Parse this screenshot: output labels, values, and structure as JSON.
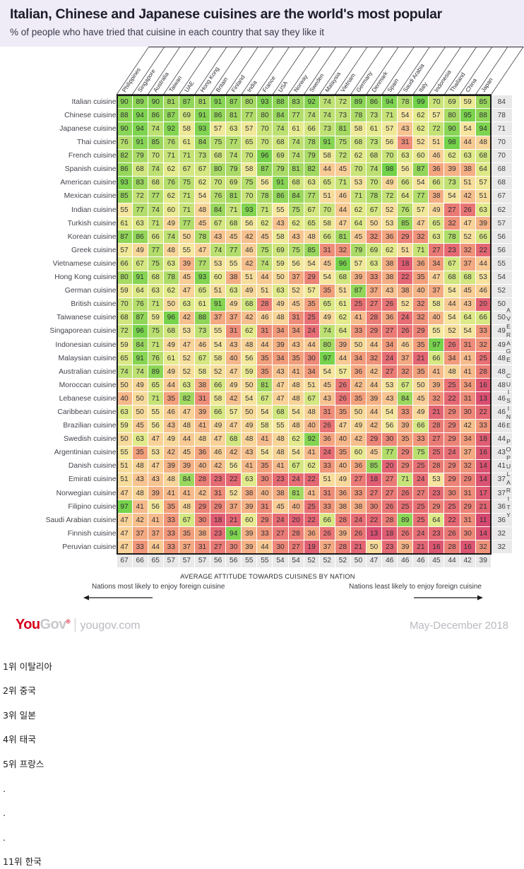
{
  "header": {
    "title": "Italian, Chinese and Japanese cuisines are the world's most popular",
    "subtitle": "% of people who have tried that cuisine in each country that say they like it"
  },
  "footer": {
    "logo_you": "You",
    "logo_gov": "Gov",
    "logo_tm": "®",
    "logo_domain": "yougov.com",
    "date": "May-December 2018"
  },
  "axis": {
    "bottom_caption": "AVERAGE ATTITUDE TOWARDS CUISINES BY NATION",
    "left_note": "Nations most likely to enjoy foreign cuisine",
    "right_note": "Nations least likely to enjoy foreign cuisine",
    "right_vertical_label": "AVERAGE CUISINE POPULARITY"
  },
  "korean_notes": [
    "1위 이탈리아",
    "2위 중국",
    "3위 일본",
    "4위 태국",
    "5위 프랑스",
    ".",
    ".",
    ".",
    "11위 한국"
  ],
  "palette": {
    "high": "#7ed957",
    "mid": "#f2e98a",
    "low": "#e8607a",
    "avg_bg": "#e9e9e9",
    "header_bg": "#efecf7",
    "brand_red": "#d6001c"
  },
  "chart_data": {
    "type": "heatmap",
    "title": "Italian, Chinese and Japanese cuisines are the world's most popular",
    "subtitle": "% of people who have tried that cuisine in each country that say they like it",
    "xlabel": "AVERAGE ATTITUDE TOWARDS CUISINES BY NATION",
    "ylabel": "AVERAGE CUISINE POPULARITY",
    "value_range": [
      11,
      99
    ],
    "columns": [
      "Philippines",
      "Singapore",
      "Australia",
      "Taiwan",
      "UAE",
      "Hong Kong",
      "Britain",
      "Finland",
      "India",
      "France",
      "USA",
      "Norway",
      "Sweden",
      "Malaysia",
      "Vietnam",
      "Germany",
      "Denmark",
      "Spain",
      "Saudi Arabia",
      "Italy",
      "Indonesia",
      "Thailand",
      "China",
      "Japan"
    ],
    "rows": [
      {
        "label": "Italian cuisine",
        "values": [
          90,
          89,
          90,
          81,
          87,
          81,
          91,
          87,
          80,
          93,
          88,
          83,
          92,
          74,
          72,
          89,
          86,
          94,
          78,
          99,
          70,
          69,
          59,
          85
        ],
        "avg": 84
      },
      {
        "label": "Chinese cuisine",
        "values": [
          88,
          94,
          86,
          87,
          69,
          91,
          86,
          81,
          77,
          80,
          84,
          77,
          74,
          74,
          73,
          78,
          73,
          71,
          54,
          62,
          57,
          80,
          95,
          88
        ],
        "avg": 78
      },
      {
        "label": "Japanese cuisine",
        "values": [
          90,
          94,
          74,
          92,
          58,
          93,
          57,
          63,
          57,
          70,
          74,
          61,
          66,
          73,
          81,
          58,
          61,
          57,
          43,
          62,
          72,
          90,
          54,
          94
        ],
        "avg": 71
      },
      {
        "label": "Thai cuisine",
        "values": [
          76,
          91,
          85,
          76,
          61,
          84,
          75,
          77,
          65,
          70,
          68,
          74,
          78,
          91,
          75,
          68,
          73,
          56,
          31,
          52,
          51,
          98,
          44,
          48
        ],
        "avg": 70
      },
      {
        "label": "French cuisine",
        "values": [
          82,
          79,
          70,
          71,
          71,
          73,
          68,
          74,
          70,
          96,
          69,
          74,
          79,
          58,
          72,
          62,
          68,
          70,
          63,
          60,
          46,
          62,
          63,
          68
        ],
        "avg": 70
      },
      {
        "label": "Spanish cuisine",
        "values": [
          86,
          68,
          74,
          62,
          67,
          67,
          80,
          79,
          58,
          87,
          79,
          81,
          82,
          44,
          45,
          70,
          74,
          98,
          56,
          87,
          36,
          39,
          38,
          64
        ],
        "avg": 68
      },
      {
        "label": "American cuisine",
        "values": [
          93,
          83,
          68,
          76,
          75,
          62,
          70,
          69,
          75,
          56,
          91,
          68,
          63,
          65,
          71,
          53,
          70,
          49,
          66,
          54,
          66,
          73,
          51,
          57
        ],
        "avg": 68
      },
      {
        "label": "Mexican cuisine",
        "values": [
          85,
          72,
          77,
          62,
          71,
          54,
          76,
          81,
          70,
          78,
          86,
          84,
          77,
          51,
          46,
          71,
          78,
          72,
          64,
          77,
          38,
          54,
          42,
          51
        ],
        "avg": 67
      },
      {
        "label": "Indian cuisine",
        "values": [
          55,
          77,
          74,
          60,
          71,
          48,
          84,
          71,
          93,
          71,
          55,
          75,
          67,
          70,
          44,
          62,
          67,
          52,
          76,
          57,
          49,
          27,
          26,
          63
        ],
        "avg": 62
      },
      {
        "label": "Turkish cuisine",
        "values": [
          61,
          63,
          71,
          49,
          77,
          45,
          67,
          68,
          56,
          62,
          43,
          62,
          65,
          58,
          47,
          64,
          50,
          53,
          85,
          47,
          65,
          32,
          47,
          39
        ],
        "avg": 57
      },
      {
        "label": "Korean cuisine",
        "values": [
          87,
          86,
          66,
          74,
          50,
          78,
          43,
          45,
          42,
          45,
          58,
          43,
          48,
          66,
          81,
          45,
          32,
          36,
          29,
          32,
          63,
          78,
          52,
          66
        ],
        "avg": 56
      },
      {
        "label": "Greek cuisine",
        "values": [
          57,
          49,
          77,
          48,
          55,
          47,
          74,
          77,
          46,
          75,
          69,
          75,
          85,
          31,
          32,
          79,
          69,
          62,
          51,
          71,
          27,
          23,
          32,
          22
        ],
        "avg": 56
      },
      {
        "label": "Vietnamese cuisine",
        "values": [
          66,
          67,
          75,
          63,
          39,
          77,
          53,
          55,
          42,
          74,
          59,
          56,
          54,
          45,
          96,
          57,
          63,
          38,
          18,
          36,
          34,
          67,
          37,
          44
        ],
        "avg": 55
      },
      {
        "label": "Hong Kong cuisine",
        "values": [
          80,
          91,
          68,
          78,
          45,
          93,
          60,
          38,
          51,
          44,
          50,
          37,
          29,
          54,
          68,
          39,
          33,
          38,
          22,
          35,
          47,
          68,
          68,
          53
        ],
        "avg": 54
      },
      {
        "label": "German cuisine",
        "values": [
          59,
          64,
          63,
          62,
          47,
          65,
          51,
          63,
          49,
          51,
          63,
          52,
          57,
          35,
          51,
          87,
          37,
          43,
          38,
          40,
          37,
          54,
          45,
          46
        ],
        "avg": 52
      },
      {
        "label": "British cuisine",
        "values": [
          70,
          76,
          71,
          50,
          63,
          61,
          91,
          49,
          68,
          28,
          49,
          45,
          35,
          65,
          61,
          25,
          27,
          26,
          52,
          32,
          58,
          44,
          43,
          20
        ],
        "avg": 50
      },
      {
        "label": "Taiwanese cuisine",
        "values": [
          68,
          87,
          59,
          96,
          42,
          88,
          37,
          37,
          42,
          46,
          48,
          31,
          25,
          49,
          62,
          41,
          28,
          36,
          24,
          32,
          40,
          54,
          64,
          66
        ],
        "avg": 50
      },
      {
        "label": "Singaporean cuisine",
        "values": [
          72,
          96,
          75,
          68,
          53,
          73,
          55,
          31,
          62,
          31,
          34,
          34,
          24,
          74,
          64,
          33,
          29,
          27,
          26,
          29,
          55,
          52,
          54,
          33
        ],
        "avg": 49
      },
      {
        "label": "Indonesian cuisine",
        "values": [
          59,
          84,
          71,
          49,
          47,
          46,
          54,
          43,
          48,
          44,
          39,
          43,
          44,
          80,
          39,
          50,
          44,
          34,
          46,
          35,
          97,
          26,
          31,
          32
        ],
        "avg": 49
      },
      {
        "label": "Malaysian cuisine",
        "values": [
          65,
          91,
          76,
          61,
          52,
          67,
          58,
          40,
          56,
          35,
          34,
          35,
          30,
          97,
          44,
          34,
          32,
          24,
          37,
          21,
          66,
          34,
          41,
          25
        ],
        "avg": 48
      },
      {
        "label": "Australian cuisine",
        "values": [
          74,
          74,
          89,
          49,
          52,
          58,
          52,
          47,
          59,
          35,
          43,
          41,
          34,
          54,
          57,
          36,
          42,
          27,
          32,
          35,
          41,
          48,
          41,
          28
        ],
        "avg": 48
      },
      {
        "label": "Moroccan cuisine",
        "values": [
          50,
          49,
          65,
          44,
          63,
          38,
          66,
          49,
          50,
          81,
          47,
          48,
          51,
          45,
          26,
          42,
          44,
          53,
          67,
          50,
          39,
          25,
          34,
          16
        ],
        "avg": 48
      },
      {
        "label": "Lebanese cuisine",
        "values": [
          40,
          50,
          71,
          35,
          82,
          31,
          58,
          42,
          54,
          67,
          47,
          48,
          67,
          43,
          26,
          35,
          39,
          43,
          84,
          45,
          32,
          22,
          31,
          13
        ],
        "avg": 46
      },
      {
        "label": "Caribbean cuisine",
        "values": [
          63,
          50,
          55,
          46,
          47,
          39,
          66,
          57,
          50,
          54,
          68,
          54,
          48,
          31,
          35,
          50,
          44,
          54,
          33,
          49,
          21,
          29,
          30,
          22
        ],
        "avg": 46
      },
      {
        "label": "Brazilian cuisine",
        "values": [
          59,
          45,
          56,
          43,
          48,
          41,
          49,
          47,
          49,
          58,
          55,
          48,
          40,
          26,
          47,
          49,
          42,
          56,
          39,
          66,
          28,
          29,
          42,
          33
        ],
        "avg": 46
      },
      {
        "label": "Swedish cuisine",
        "values": [
          50,
          63,
          47,
          49,
          44,
          48,
          47,
          68,
          48,
          41,
          48,
          62,
          92,
          36,
          40,
          42,
          29,
          30,
          35,
          33,
          27,
          29,
          34,
          18
        ],
        "avg": 44
      },
      {
        "label": "Argentinian cuisine",
        "values": [
          55,
          35,
          53,
          42,
          45,
          36,
          46,
          42,
          43,
          54,
          48,
          54,
          41,
          24,
          35,
          60,
          45,
          77,
          29,
          75,
          25,
          24,
          37,
          16
        ],
        "avg": 43
      },
      {
        "label": "Danish cuisine",
        "values": [
          51,
          48,
          47,
          39,
          39,
          40,
          42,
          56,
          41,
          35,
          41,
          67,
          62,
          33,
          40,
          36,
          85,
          20,
          29,
          25,
          28,
          29,
          32,
          14
        ],
        "avg": 41
      },
      {
        "label": "Emirati cuisine",
        "values": [
          51,
          43,
          43,
          48,
          84,
          28,
          23,
          22,
          63,
          30,
          23,
          24,
          22,
          51,
          49,
          27,
          18,
          27,
          71,
          24,
          53,
          29,
          29,
          14
        ],
        "avg": 37
      },
      {
        "label": "Norwegian cuisine",
        "values": [
          47,
          48,
          39,
          41,
          41,
          42,
          31,
          52,
          38,
          40,
          38,
          81,
          41,
          31,
          36,
          33,
          27,
          27,
          26,
          27,
          23,
          30,
          31,
          17
        ],
        "avg": 37
      },
      {
        "label": "Filipino cuisine",
        "values": [
          97,
          41,
          56,
          35,
          48,
          29,
          29,
          37,
          39,
          31,
          45,
          40,
          25,
          33,
          38,
          38,
          30,
          26,
          25,
          25,
          29,
          25,
          29,
          21
        ],
        "avg": 36
      },
      {
        "label": "Saudi Arabian cuisine",
        "values": [
          47,
          42,
          41,
          33,
          67,
          30,
          18,
          21,
          60,
          29,
          24,
          20,
          22,
          66,
          28,
          24,
          22,
          28,
          89,
          25,
          64,
          22,
          31,
          11
        ],
        "avg": 36
      },
      {
        "label": "Finnish cuisine",
        "values": [
          47,
          37,
          37,
          33,
          35,
          38,
          23,
          94,
          39,
          33,
          27,
          28,
          36,
          26,
          39,
          26,
          13,
          18,
          26,
          24,
          23,
          26,
          30,
          14
        ],
        "avg": 32
      },
      {
        "label": "Peruvian cuisine",
        "values": [
          47,
          33,
          44,
          33,
          37,
          31,
          27,
          30,
          39,
          44,
          30,
          27,
          19,
          37,
          28,
          21,
          50,
          23,
          39,
          21,
          16,
          28,
          16,
          32
        ],
        "avg": 32
      }
    ],
    "column_averages": [
      67,
      66,
      65,
      57,
      57,
      57,
      56,
      56,
      55,
      55,
      54,
      54,
      52,
      52,
      52,
      50,
      47,
      46,
      46,
      46,
      45,
      44,
      42,
      39
    ]
  }
}
